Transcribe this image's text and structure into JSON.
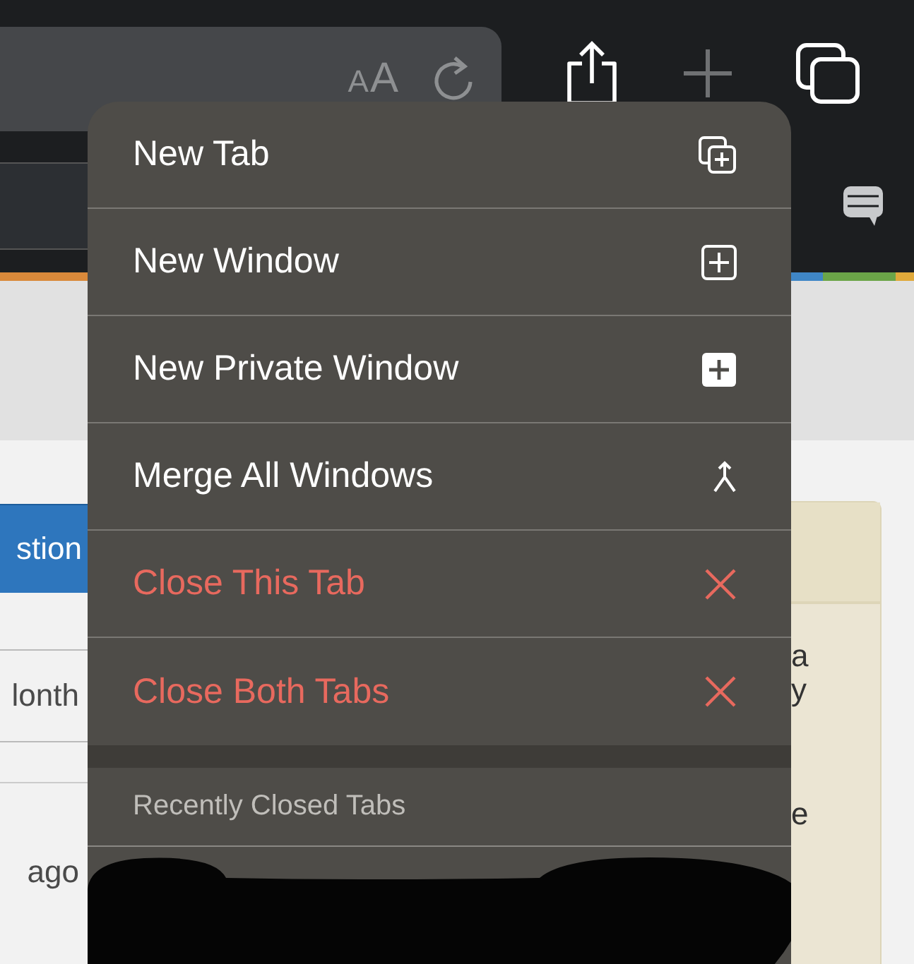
{
  "toolbar": {
    "text_size_button": "AA"
  },
  "page": {
    "left_button": "stion",
    "left_cells": [
      "lonth",
      "ago"
    ],
    "right_fragments": [
      "a",
      "y",
      "e"
    ]
  },
  "menu": {
    "items": [
      {
        "label": "New Tab",
        "kind": "normal"
      },
      {
        "label": "New Window",
        "kind": "normal"
      },
      {
        "label": "New Private Window",
        "kind": "normal"
      },
      {
        "label": "Merge All Windows",
        "kind": "normal"
      },
      {
        "label": "Close This Tab",
        "kind": "destructive"
      },
      {
        "label": "Close Both Tabs",
        "kind": "destructive"
      }
    ],
    "section_header": "Recently Closed Tabs"
  }
}
